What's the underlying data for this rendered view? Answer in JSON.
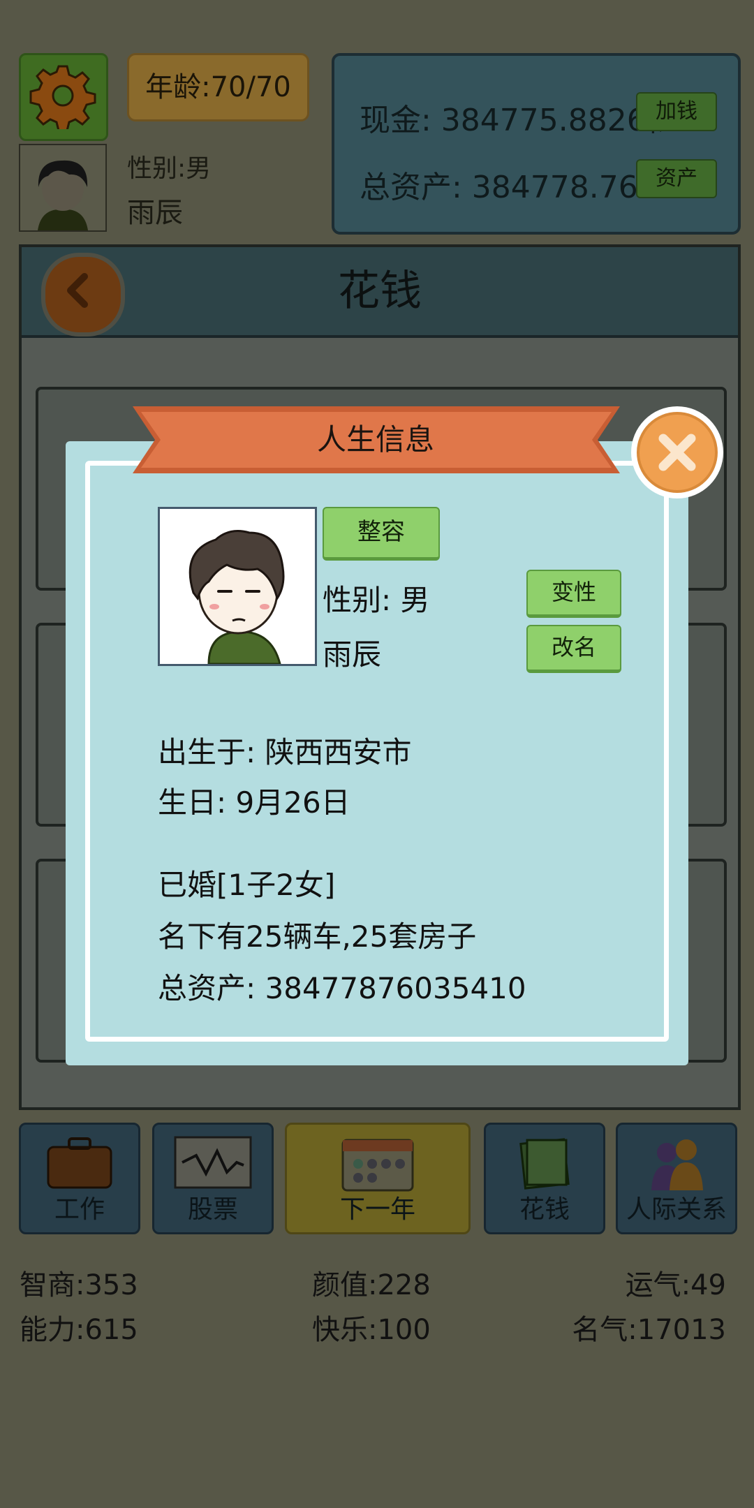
{
  "top": {
    "age": "年龄:70/70",
    "gender": "性别:男",
    "name": "雨辰",
    "cash": "现金: 384775.8826亿",
    "total_assets": "总资产: 384778.7604亿",
    "add_money_label": "加钱",
    "assets_label": "资产"
  },
  "main": {
    "title": "花钱"
  },
  "dialog": {
    "title": "人生信息",
    "reshape_label": "整容",
    "gender": "性别: 男",
    "change_gender_label": "变性",
    "name": "雨辰",
    "rename_label": "改名",
    "birthplace": "出生于:  陕西西安市",
    "birthday": "生日:  9月26日",
    "marital": "已婚[1子2女]",
    "property": "名下有25辆车,25套房子",
    "total_assets": "总资产:  38477876035410"
  },
  "nav": [
    {
      "label": "工作",
      "icon": "briefcase-icon"
    },
    {
      "label": "股票",
      "icon": "stock-chart-icon"
    },
    {
      "label": "下一年",
      "icon": "calendar-icon"
    },
    {
      "label": "花钱",
      "icon": "money-icon"
    },
    {
      "label": "人际关系",
      "icon": "people-icon"
    }
  ],
  "stats": {
    "iq": "智商:353",
    "looks": "颜值:228",
    "luck": "运气:49",
    "ability": "能力:615",
    "happiness": "快乐:100",
    "fame": "名气:17013"
  },
  "colors": {
    "dialog_bg": "#b4dde0",
    "banner": "#e0774a",
    "close_button": "#f0a050",
    "green_button": "#8fd06b"
  }
}
